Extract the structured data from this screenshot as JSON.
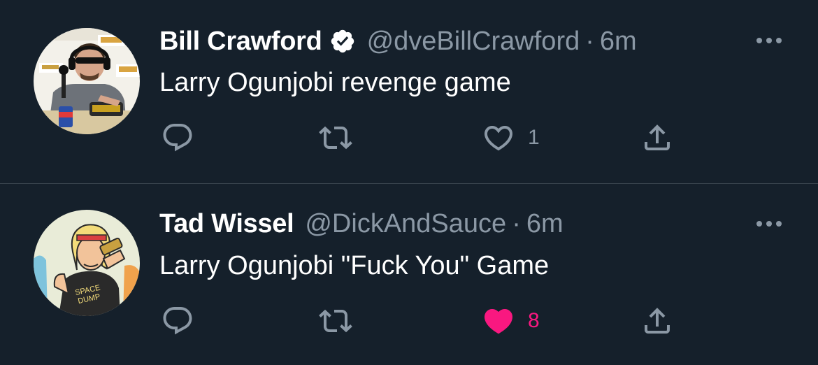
{
  "colors": {
    "background": "#15202b",
    "text_primary": "#ffffff",
    "text_secondary": "#8b98a5",
    "divider": "#38444d",
    "like_active": "#f91880"
  },
  "tweets": [
    {
      "display_name": "Bill Crawford",
      "verified": true,
      "handle": "@dveBillCrawford",
      "separator": "·",
      "time": "6m",
      "text": "Larry Ogunjobi revenge game",
      "reply_count": "",
      "retweet_count": "",
      "like_count": "1",
      "liked": false,
      "icons": [
        "reply-icon",
        "retweet-icon",
        "heart-outline-icon",
        "share-icon",
        "more-icon",
        "verified-badge-icon"
      ]
    },
    {
      "display_name": "Tad Wissel",
      "verified": false,
      "handle": "@DickAndSauce",
      "separator": "·",
      "time": "6m",
      "text": "Larry Ogunjobi \"Fuck You\" Game",
      "reply_count": "",
      "retweet_count": "",
      "like_count": "8",
      "liked": true,
      "icons": [
        "reply-icon",
        "retweet-icon",
        "heart-filled-icon",
        "share-icon",
        "more-icon"
      ]
    }
  ]
}
